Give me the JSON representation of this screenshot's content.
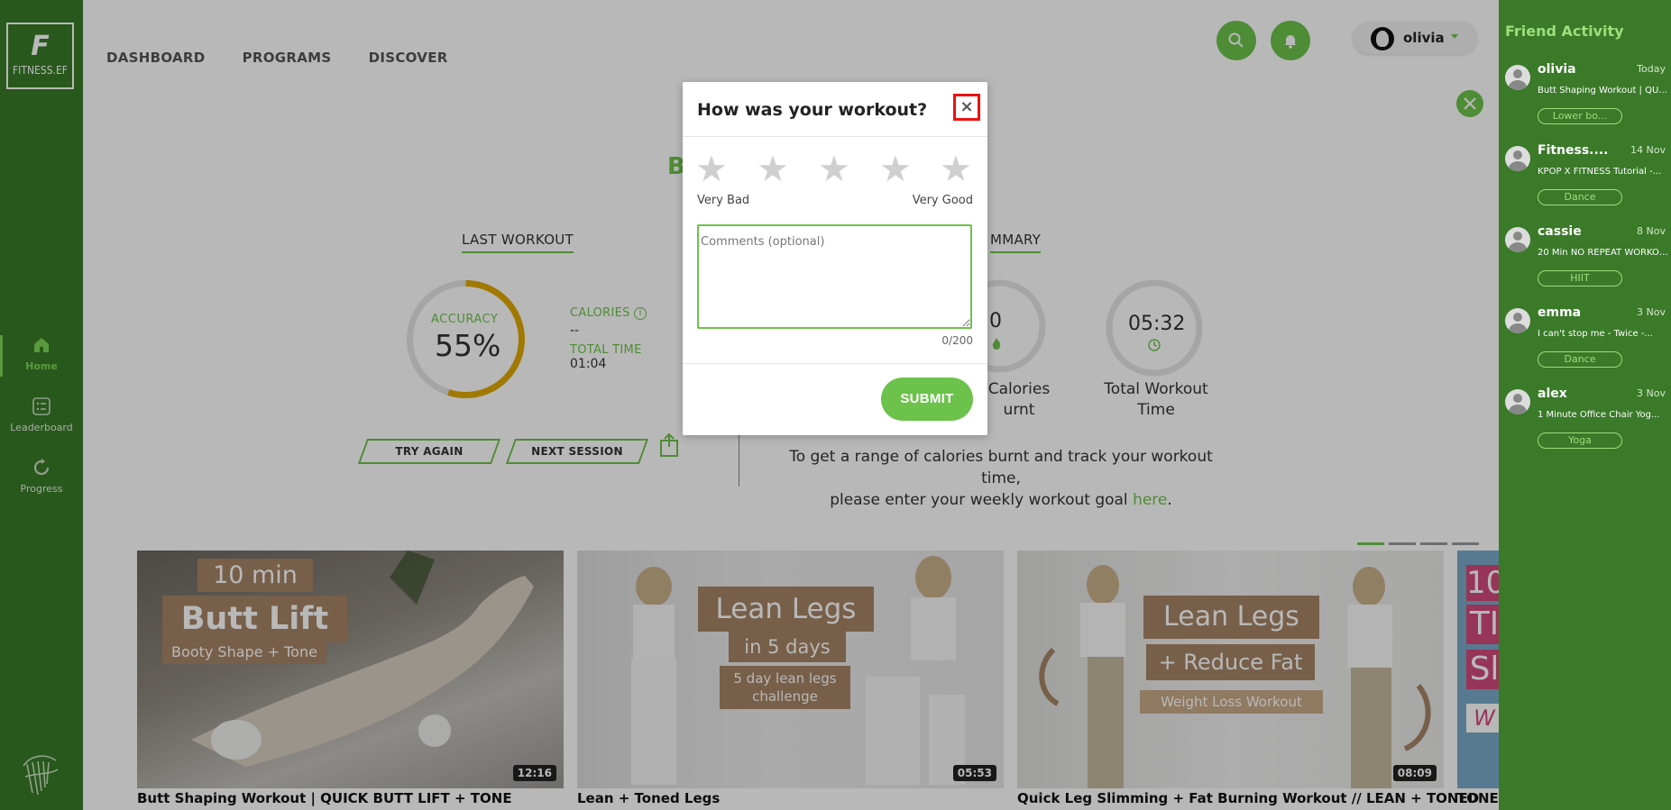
{
  "brand": {
    "logo_letter": "F",
    "logo_text": "FITNESS.EF"
  },
  "sidebar": {
    "items": [
      {
        "label": "Home",
        "icon": "home-icon",
        "active": true
      },
      {
        "label": "Leaderboard",
        "icon": "leaderboard-icon"
      },
      {
        "label": "Progress",
        "icon": "progress-icon"
      }
    ]
  },
  "topnav": {
    "items": [
      "DASHBOARD",
      "PROGRAMS",
      "DISCOVER"
    ]
  },
  "header": {
    "search_icon": "search-icon",
    "bell_icon": "bell-icon",
    "username": "olivia"
  },
  "dashboard": {
    "section_title_partial": "B",
    "last_workout": {
      "tab_label": "LAST WORKOUT",
      "accuracy_label": "ACCURACY",
      "accuracy_value": "55%",
      "accuracy_fraction": 0.55,
      "calories_label": "CALORIES",
      "calories_value": "--",
      "total_time_label": "TOTAL TIME",
      "total_time_value": "01:04",
      "try_again": "TRY AGAIN",
      "next_session": "NEXT SESSION"
    },
    "summary": {
      "tab_label_partial": "MMARY",
      "calories_value_partial": "0",
      "calories_label_line1": "Calories",
      "calories_label_line2": "urnt",
      "time_value": "05:32",
      "time_label_line1": "Total Workout",
      "time_label_line2": "Time",
      "goal_text_1": "To get a range of calories burnt and track your workout time,",
      "goal_text_2": "please enter your weekly workout goal ",
      "goal_link": "here",
      "goal_text_end": "."
    }
  },
  "videos": [
    {
      "title": "Butt Shaping Workout | QUICK BUTT LIFT + TONE",
      "duration": "12:16",
      "thumb_line1": "10 min",
      "thumb_line2": "Butt Lift",
      "thumb_line3": "Booty Shape + Tone"
    },
    {
      "title": "Lean + Toned Legs",
      "duration": "05:53",
      "thumb_line1": "Lean Legs",
      "thumb_line2": "in 5 days",
      "thumb_line3": "5 day lean legs",
      "thumb_line4": "challenge"
    },
    {
      "title": "Quick Leg Slimming + Fat Burning Workout // LEAN + TONED",
      "duration": "08:09",
      "thumb_line1": "Lean Legs",
      "thumb_line2": "+ Reduce Fat",
      "thumb_line3": "Weight Loss Workout"
    },
    {
      "title": "TONEI",
      "thumb_line1": "10",
      "thumb_line2": "TI",
      "thumb_line3": "Sl",
      "thumb_line4": "W"
    }
  ],
  "friend_activity": {
    "title": "Friend Activity",
    "items": [
      {
        "name": "olivia",
        "date": "Today",
        "activity": "Butt Shaping Workout | QU...",
        "tag": "Lower bo..."
      },
      {
        "name": "Fitness....",
        "date": "14 Nov",
        "activity": "KPOP X FITNESS Tutorial -...",
        "tag": "Dance"
      },
      {
        "name": "cassie",
        "date": "8 Nov",
        "activity": "20 Min NO REPEAT WORKOUT ...",
        "tag": "HIIT"
      },
      {
        "name": "emma",
        "date": "3 Nov",
        "activity": "I can't stop me - Twice -...",
        "tag": "Dance"
      },
      {
        "name": "alex",
        "date": "3 Nov",
        "activity": "1 Minute Office Chair Yog...",
        "tag": "Yoga"
      }
    ]
  },
  "modal": {
    "title": "How was your workout?",
    "close_label": "×",
    "rating_stars": 5,
    "rating_value": 0,
    "low_label": "Very Bad",
    "high_label": "Very Good",
    "comments_placeholder": "Comments (optional)",
    "comments_value": "",
    "counter": "0/200",
    "submit_label": "SUBMIT"
  },
  "colors": {
    "brand_green": "#3a7a29",
    "accent_green": "#6cc24a",
    "accuracy_ring": "#e0a800",
    "close_highlight": "#ee1111"
  }
}
